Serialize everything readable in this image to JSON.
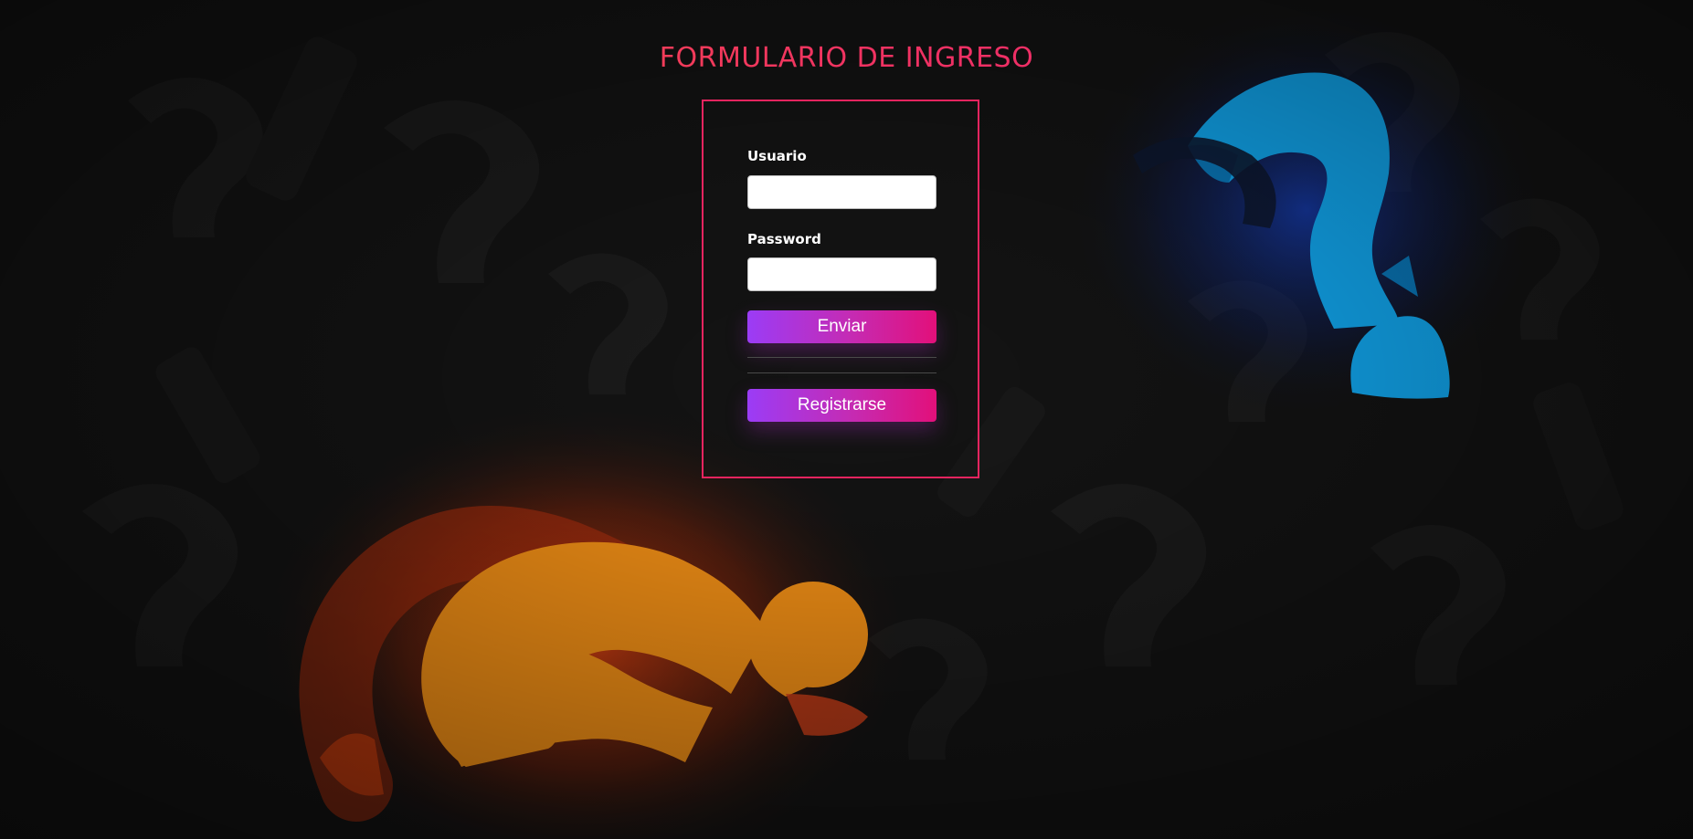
{
  "page": {
    "title": "FORMULARIO DE INGRESO"
  },
  "form": {
    "user_label": "Usuario",
    "user_value": "",
    "password_label": "Password",
    "password_value": "",
    "submit_label": "Enviar",
    "register_label": "Registrarse"
  },
  "background": {
    "description_icon": "question-marks-art",
    "colors": {
      "base": "#141414",
      "orange": "#ff9717",
      "orange_glow": "#ff4a12",
      "blue": "#12b2ff",
      "blue_glow": "#1747d8"
    }
  },
  "colors": {
    "accent": "#e8245f",
    "button_start": "#9b3cf6",
    "button_end": "#e2107a"
  }
}
